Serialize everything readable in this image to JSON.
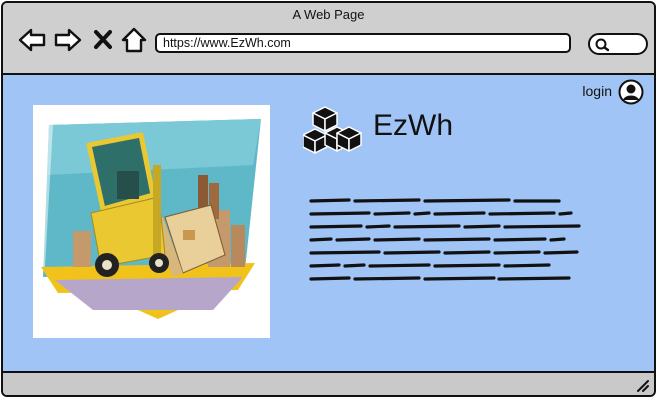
{
  "window": {
    "title": "A Web Page"
  },
  "toolbar": {
    "icons": [
      "back-arrow-icon",
      "forward-arrow-icon",
      "close-x-icon",
      "home-icon"
    ],
    "url": "https://www.EzWh.com",
    "search_icon": "search-icon"
  },
  "header": {
    "login_label": "login",
    "user_icon": "user-avatar-icon"
  },
  "brand": {
    "name": "EzWh",
    "logo_icon": "boxes-stack-icon"
  },
  "hero": {
    "image": "forklift-warehouse-illustration"
  },
  "body_text": {
    "placeholder": "scribbled-lorem-text"
  }
}
